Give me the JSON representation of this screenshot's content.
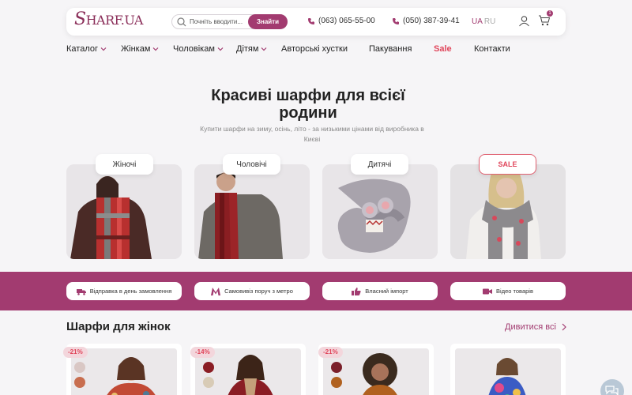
{
  "header": {
    "logo_main": "S",
    "logo_rest": "HARF.UA",
    "search_placeholder": "Почніть вводити...",
    "search_button": "Знайти",
    "phone1": "(063) 065-55-00",
    "phone2": "(050) 387-39-41",
    "lang_active": "UA",
    "lang_inactive": "RU",
    "cart_count": "1"
  },
  "nav": {
    "catalog": "Каталог",
    "women": "Жінкам",
    "men": "Чоловікам",
    "kids": "Дітям",
    "author": "Авторські хустки",
    "packaging": "Пакування",
    "sale": "Sale",
    "contacts": "Контакти"
  },
  "hero": {
    "title": "Красиві шарфи для всієї родини",
    "subtitle": "Купити шарфи на зиму, осінь, літо - за низькими цінами від виробника в Києві"
  },
  "categories": [
    {
      "label": "Жіночі"
    },
    {
      "label": "Чоловічі"
    },
    {
      "label": "Дитячі"
    },
    {
      "label": "SALE"
    }
  ],
  "benefits": [
    {
      "label": "Відправка в день замовлення",
      "icon": "truck-icon"
    },
    {
      "label": "Самовивіз поруч з метро",
      "icon": "metro-icon"
    },
    {
      "label": "Власний імпорт",
      "icon": "thumbs-up-icon"
    },
    {
      "label": "Відео товарів",
      "icon": "video-icon"
    }
  ],
  "section": {
    "title": "Шарфи для жінок",
    "see_all": "Дивитися всі"
  },
  "products": [
    {
      "discount": "-21%"
    },
    {
      "discount": "-14%"
    },
    {
      "discount": "-21%"
    },
    {
      "discount": ""
    }
  ],
  "colors": {
    "brand": "#a23b70",
    "sale": "#e0465b",
    "background": "#f6f5f7"
  }
}
